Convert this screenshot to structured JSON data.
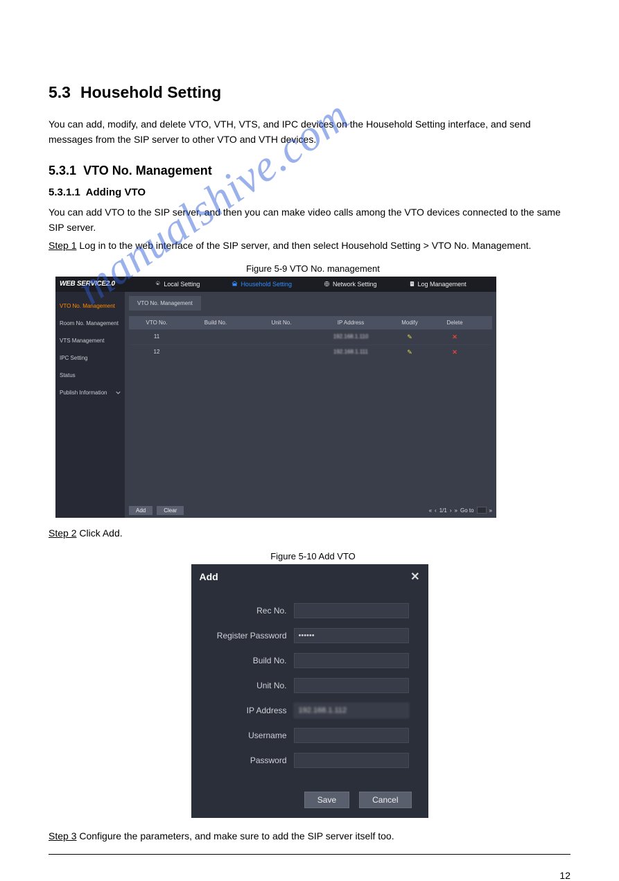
{
  "doc": {
    "section_number": "5.3",
    "section_title": "Household Setting",
    "intro": "You can add, modify, and delete VTO, VTH, VTS, and IPC devices on the Household Setting interface, and send messages from the SIP server to other VTO and VTH devices.",
    "subsection_number": "5.3.1",
    "subsection_title": "VTO No. Management",
    "subsub_number": "5.3.1.1",
    "subsub_title": "Adding VTO",
    "subsub_intro": "You can add VTO to the SIP server, and then you can make video calls among the VTO devices connected to the same SIP server.",
    "step1_lead": "Step 1",
    "step1_text": " Log in to the web interface of the SIP server, and then select Household Setting > VTO No. Management.",
    "figure1_label": "Figure 5-9 VTO No. management",
    "step2_lead": "Step 2",
    "step2_text": " Click Add.",
    "figure2_label": "Figure 5-10 Add VTO",
    "step3_lead": "Step 3",
    "step3_text": " Configure the parameters, and make sure to add the SIP server itself too.",
    "footer_page": "12"
  },
  "shot1": {
    "brand": "WEB SERVICE2.0",
    "nav": {
      "local": "Local Setting",
      "household": "Household Setting",
      "network": "Network Setting",
      "log": "Log Management"
    },
    "side": {
      "vtono": "VTO No. Management",
      "roomno": "Room No. Management",
      "vts": "VTS Management",
      "ipc": "IPC Setting",
      "status": "Status",
      "publish": "Publish Information"
    },
    "tab": "VTO No. Management",
    "th": {
      "vto": "VTO No.",
      "build": "Build No.",
      "unit": "Unit No.",
      "ip": "IP Address",
      "modify": "Modify",
      "delete": "Delete"
    },
    "rows": [
      {
        "vto": "11",
        "ip": "192.168.1.110"
      },
      {
        "vto": "12",
        "ip": "192.168.1.111"
      }
    ],
    "buttons": {
      "add": "Add",
      "clear": "Clear"
    },
    "pager": {
      "label": "1/1",
      "goto": "Go to"
    }
  },
  "shot2": {
    "title": "Add",
    "labels": {
      "rec": "Rec No.",
      "regpwd": "Register Password",
      "build": "Build No.",
      "unit": "Unit No.",
      "ip": "IP Address",
      "user": "Username",
      "pwd": "Password"
    },
    "values": {
      "regpwd": "••••••",
      "ip": "192.168.1.112"
    },
    "buttons": {
      "save": "Save",
      "cancel": "Cancel"
    }
  },
  "watermark": "manualshive.com"
}
